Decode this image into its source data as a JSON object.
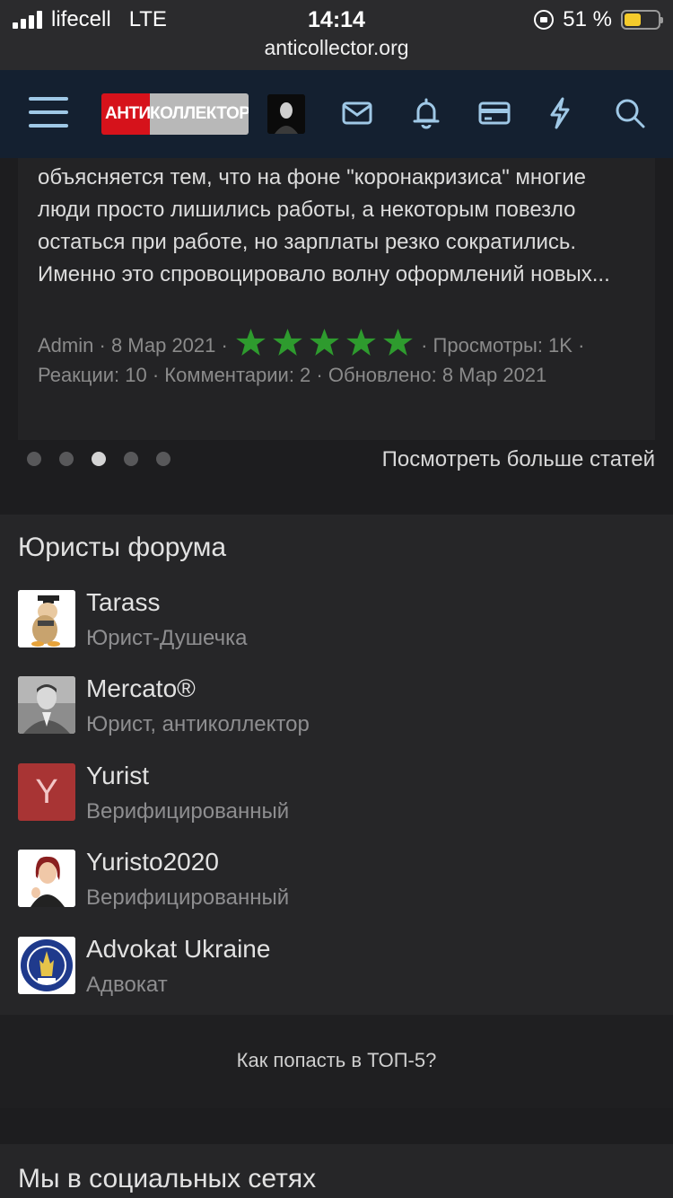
{
  "status_bar": {
    "carrier": "lifecell",
    "network": "LTE",
    "time": "14:14",
    "battery": "51 %",
    "battery_level": 0.51,
    "url": "anticollector.org"
  },
  "header": {
    "logo_red": "АНТИ",
    "logo_grey": "КОЛЛЕКТОР",
    "icons": [
      "menu-icon",
      "avatar",
      "mail-icon",
      "bell-icon",
      "card-icon",
      "lightning-icon",
      "search-icon"
    ]
  },
  "article": {
    "excerpt": "объясняется тем, что на фоне \"коронакризиса\" многие люди просто лишились работы, а некоторым повезло остаться при работе, но зарплаты резко сократились. Именно это спровоцировало волну оформлений новых...",
    "author": "Admin",
    "date": "8 Мар 2021",
    "rating": 5,
    "views": "Просмотры: 1K",
    "reactions": "Реакции: 10",
    "comments": "Комментарии: 2",
    "updated": "Обновлено: 8 Мар 2021",
    "sep": "·",
    "star_color": "#2e9b2e"
  },
  "carousel": {
    "active_index": 2,
    "count": 5,
    "more_label": "Посмотреть больше статей"
  },
  "lawyers": {
    "title": "Юристы форума",
    "items": [
      {
        "name": "Tarass",
        "role": "Юрист-Душечка",
        "avatar": "cartoon"
      },
      {
        "name": "Mercato®",
        "role": "Юрист, антиколлектор",
        "avatar": "photo"
      },
      {
        "name": "Yurist",
        "role": "Верифицированный",
        "avatar": "letter",
        "letter": "Y",
        "avatar_color": "#a83434"
      },
      {
        "name": "Yuristo2020",
        "role": "Верифицированный",
        "avatar": "woman"
      },
      {
        "name": "Advokat Ukraine",
        "role": "Адвокат",
        "avatar": "seal"
      }
    ]
  },
  "top5_link": "Как попасть в ТОП-5?",
  "social_title": "Мы в социальных сетях"
}
